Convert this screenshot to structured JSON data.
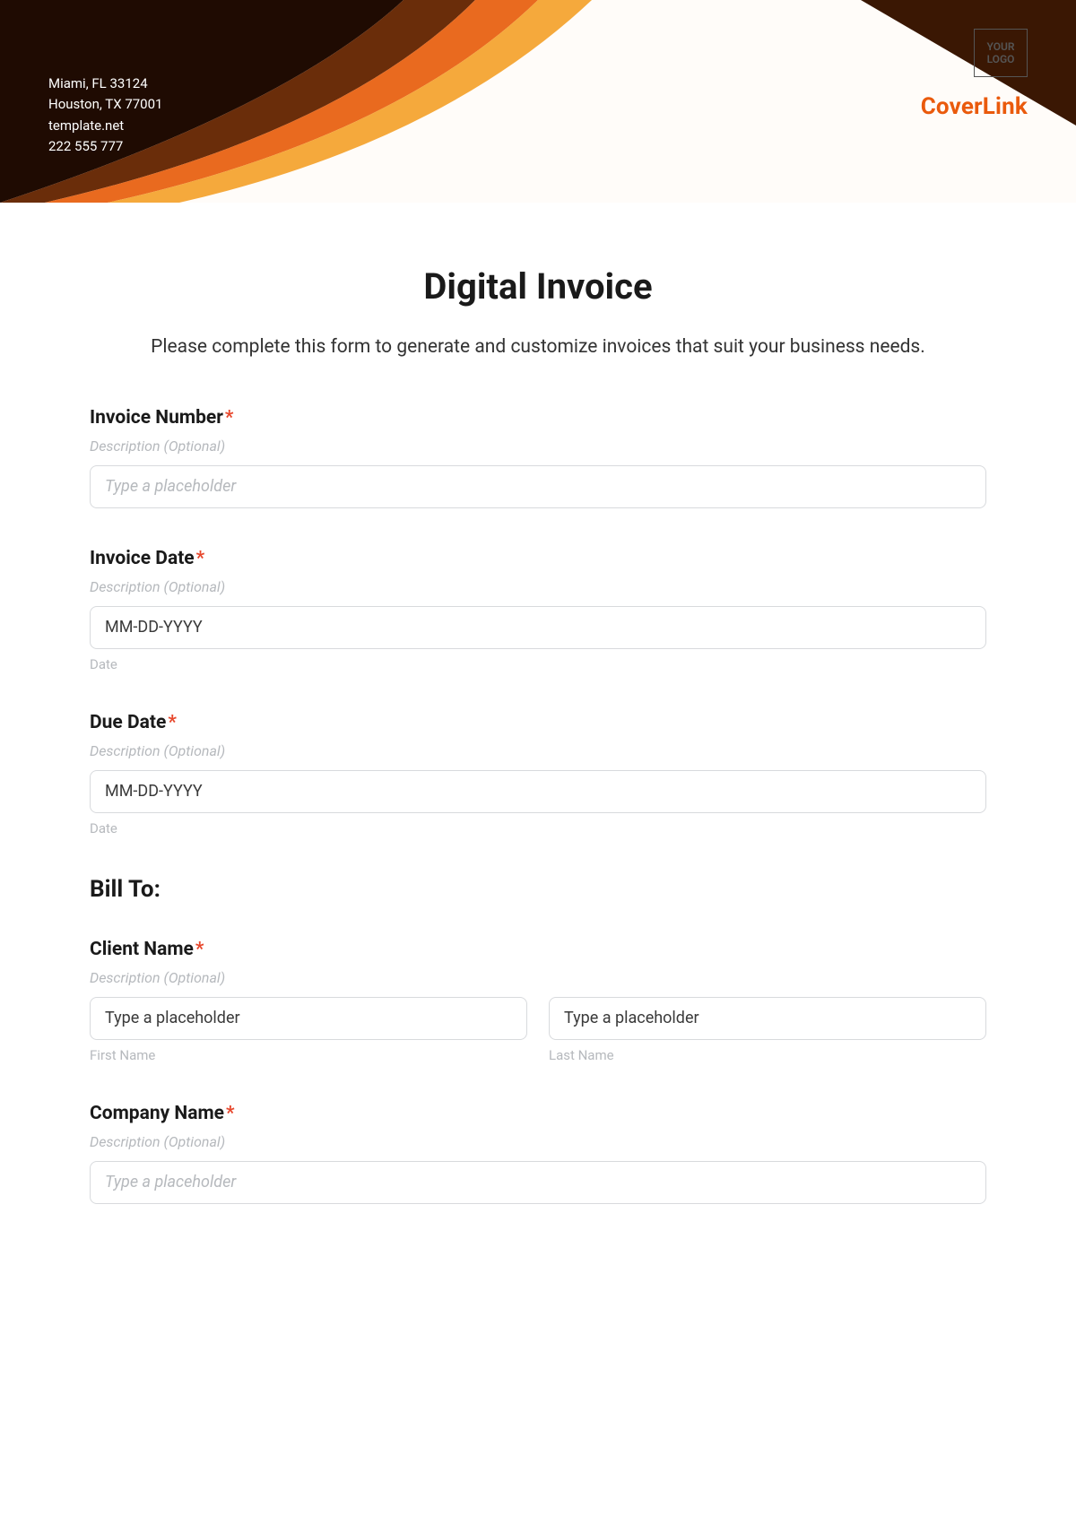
{
  "header": {
    "address_lines": [
      "Miami, FL 33124",
      "Houston, TX 77001",
      "template.net",
      "222 555 777"
    ],
    "logo_text": "YOUR LOGO",
    "brand": "CoverLink"
  },
  "page": {
    "title": "Digital Invoice",
    "description": "Please complete this form to generate and customize invoices that suit your business needs."
  },
  "fields": {
    "invoice_number": {
      "label": "Invoice Number",
      "desc": "Description (Optional)",
      "placeholder": "Type a placeholder"
    },
    "invoice_date": {
      "label": "Invoice Date",
      "desc": "Description (Optional)",
      "placeholder": "MM-DD-YYYY",
      "sublabel": "Date"
    },
    "due_date": {
      "label": "Due Date",
      "desc": "Description (Optional)",
      "placeholder": "MM-DD-YYYY",
      "sublabel": "Date"
    }
  },
  "section": {
    "bill_to": "Bill To:"
  },
  "client_name": {
    "label": "Client Name",
    "desc": "Description (Optional)",
    "first_placeholder": "Type a placeholder",
    "last_placeholder": "Type a placeholder",
    "first_sub": "First Name",
    "last_sub": "Last Name"
  },
  "company_name": {
    "label": "Company Name",
    "desc": "Description (Optional)",
    "placeholder": "Type a placeholder"
  },
  "required_marker": "*"
}
